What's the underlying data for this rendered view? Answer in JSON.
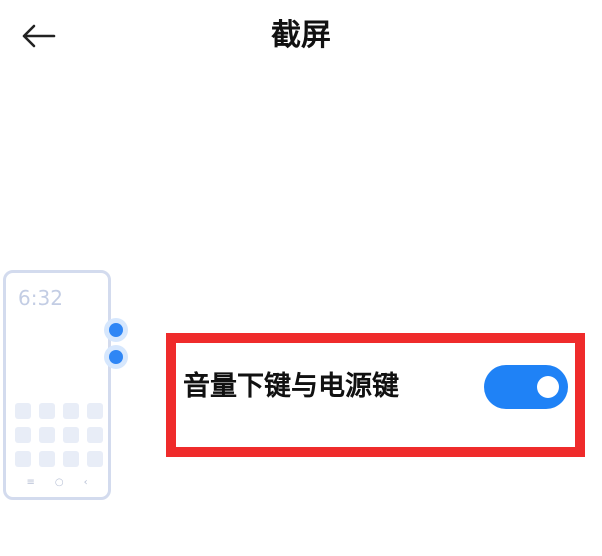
{
  "header": {
    "title": "截屏",
    "back_icon": "arrow-left-icon"
  },
  "illustration": {
    "phone_time": "6:32",
    "nav_icons": [
      "≡",
      "○",
      "‹"
    ],
    "side_key_color": "#2f86f5"
  },
  "option": {
    "label": "音量下键与电源键",
    "toggle_on": true,
    "toggle_color": "#1f82f6"
  },
  "highlight_color": "#ef2b2b"
}
